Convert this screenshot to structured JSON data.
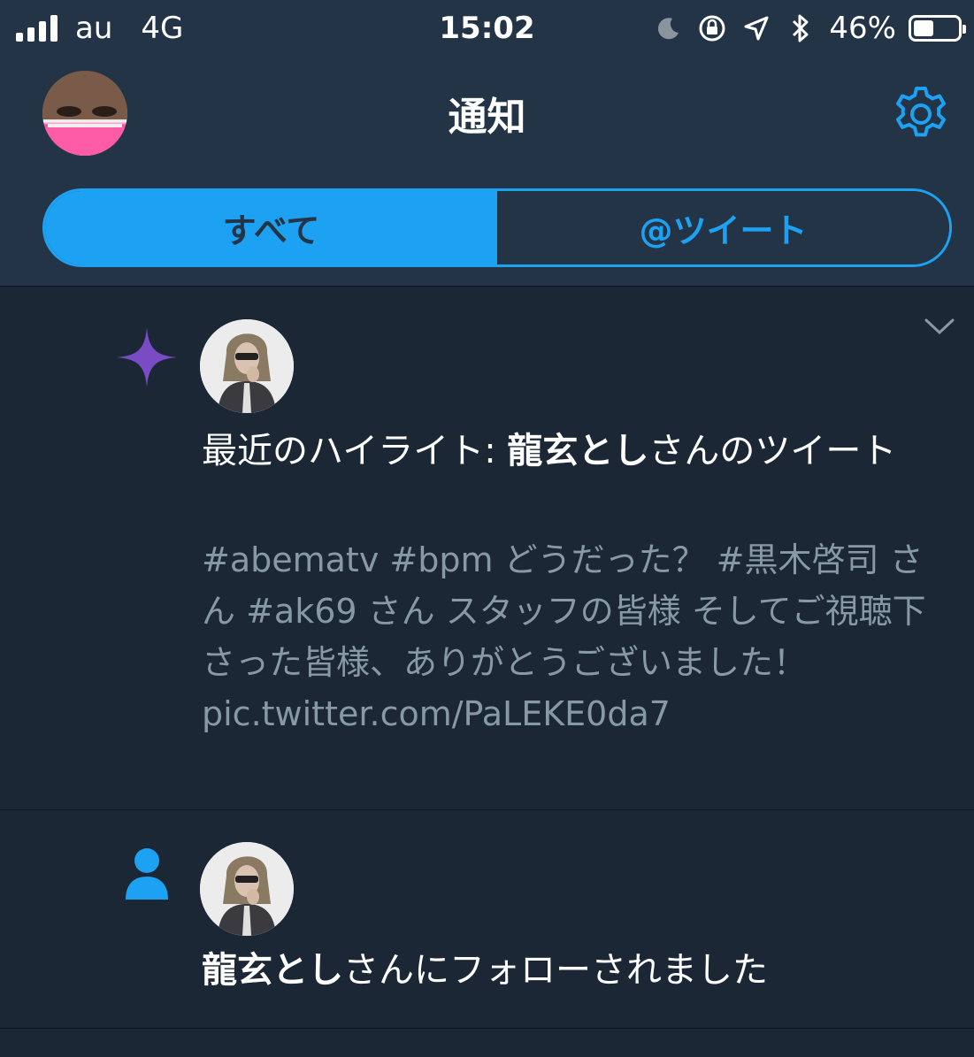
{
  "status_bar": {
    "carrier": "au",
    "network": "4G",
    "time": "15:02",
    "battery": "46%",
    "battery_level": 0.46,
    "icons": [
      "signal-icon",
      "moon-icon",
      "rotation-lock-icon",
      "location-icon",
      "bluetooth-icon",
      "battery-icon"
    ]
  },
  "nav": {
    "title": "通知",
    "settings_icon": "gear-icon"
  },
  "tabs": [
    {
      "label": "すべて",
      "active": true
    },
    {
      "label": "@ツイート",
      "active": false
    }
  ],
  "notifications": [
    {
      "type_icon": "sparkle-icon",
      "title_prefix": "最近のハイライト: ",
      "title_name": "龍玄とし",
      "title_suffix": "さんのツイート",
      "body": "#abematv #bpm どうだった？ #黒木啓司 さん #ak69 さん スタッフの皆様 そしてご視聴下さった皆様、ありがとうございました！ pic.twitter.com/PaLEKE0da7"
    },
    {
      "type_icon": "person-icon",
      "title_name": "龍玄とし",
      "title_suffix": "さんにフォローされました"
    }
  ],
  "colors": {
    "accent": "#1da1f2",
    "header_bg": "#243447",
    "body_bg": "#1b2735",
    "sparkle": "#794bc4",
    "muted_text": "#8899a6"
  }
}
